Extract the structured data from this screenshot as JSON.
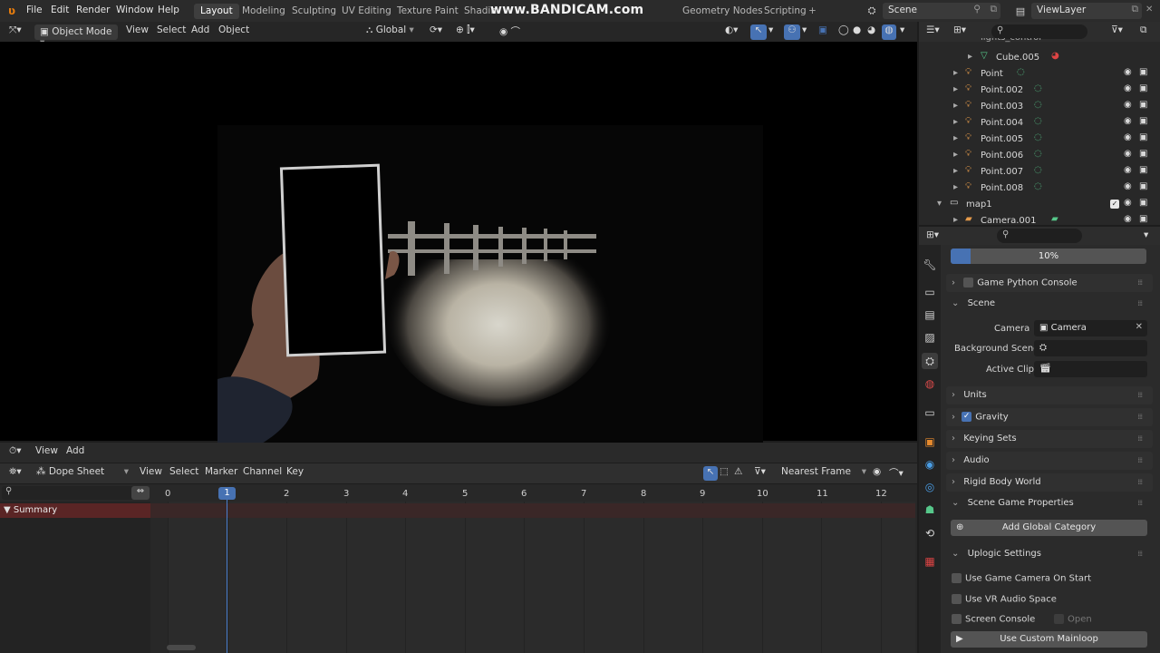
{
  "topbar": {
    "menus": [
      "File",
      "Edit",
      "Render",
      "Window",
      "Help"
    ],
    "workspaces": [
      "Layout",
      "Modeling",
      "Sculpting",
      "UV Editing",
      "Texture Paint",
      "Shadin",
      "Geometry Nodes",
      "Scripting"
    ],
    "active_workspace": "Layout",
    "add_tab": "+",
    "scene": "Scene",
    "view_layer": "ViewLayer",
    "watermark": "www.BANDICAM.com"
  },
  "viewport_header": {
    "mode": "Object Mode",
    "menus": [
      "View",
      "Select",
      "Add",
      "Object"
    ],
    "orientation": "Global"
  },
  "timeline_header": {
    "menus": [
      "View",
      "Add"
    ]
  },
  "dopesheet": {
    "mode": "Dope Sheet",
    "menus": [
      "View",
      "Select",
      "Marker",
      "Channel",
      "Key"
    ],
    "snap": "Nearest Frame",
    "frame_numbers": [
      "0",
      "1",
      "2",
      "3",
      "4",
      "5",
      "6",
      "7",
      "8",
      "9",
      "10",
      "11",
      "12"
    ],
    "current_frame": "1",
    "summary": "Summary"
  },
  "outliner": {
    "items": [
      {
        "label": "lights_control",
        "type": "collection"
      },
      {
        "label": "Cube.005",
        "type": "mesh"
      },
      {
        "label": "Point",
        "type": "light"
      },
      {
        "label": "Point.002",
        "type": "light"
      },
      {
        "label": "Point.003",
        "type": "light"
      },
      {
        "label": "Point.004",
        "type": "light"
      },
      {
        "label": "Point.005",
        "type": "light"
      },
      {
        "label": "Point.006",
        "type": "light"
      },
      {
        "label": "Point.007",
        "type": "light"
      },
      {
        "label": "Point.008",
        "type": "light"
      },
      {
        "label": "map1",
        "type": "collection"
      },
      {
        "label": "Camera.001",
        "type": "camera"
      }
    ]
  },
  "properties": {
    "progress_label": "10%",
    "progress_value": 0.1,
    "game_python_console": "Game Python Console",
    "scene_panel": "Scene",
    "camera_label": "Camera",
    "camera_value": "Camera",
    "background_scene_label": "Background Scene",
    "active_clip_label": "Active Clip",
    "units": "Units",
    "gravity": "Gravity",
    "keying_sets": "Keying Sets",
    "audio": "Audio",
    "rigid_body_world": "Rigid Body World",
    "scene_game_properties": "Scene Game Properties",
    "add_global_category": "Add Global Category",
    "uplogic_settings": "Uplogic Settings",
    "use_game_camera": "Use Game Camera On Start",
    "use_vr_audio": "Use VR Audio Space",
    "screen_console": "Screen Console",
    "open": "Open",
    "use_custom_mainloop": "Use Custom Mainloop"
  },
  "colors": {
    "accent": "#4772b3",
    "summary": "#5a2525"
  }
}
